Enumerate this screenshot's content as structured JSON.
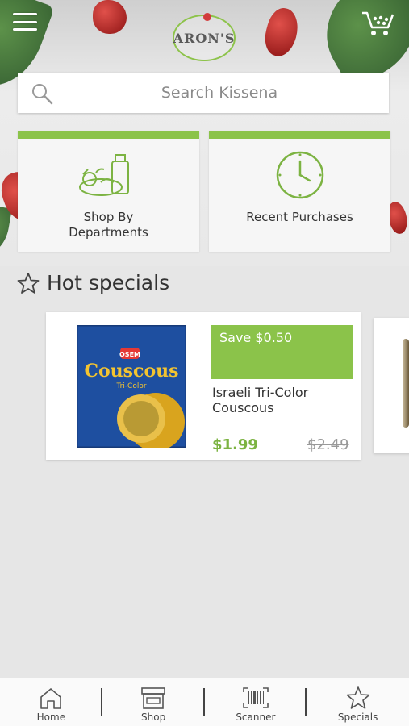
{
  "header": {
    "logo_text": "ARON'S",
    "menu_icon": "hamburger-menu-icon",
    "cart_icon": "shopping-cart-icon"
  },
  "search": {
    "placeholder": "Search Kissena",
    "icon": "search-icon"
  },
  "tiles": [
    {
      "label": "Shop By Departments",
      "icon": "groceries-icon"
    },
    {
      "label": "Recent Purchases",
      "icon": "clock-icon"
    }
  ],
  "specials": {
    "title": "Hot specials",
    "icon": "star-outline-icon",
    "items": [
      {
        "badge": "Save $0.50",
        "name": "Israeli Tri-Color Couscous",
        "price": "$1.99",
        "old_price": "$2.49",
        "image_brand": "OSEM",
        "image_title": "Couscous",
        "image_subtitle": "Tri-Color"
      }
    ]
  },
  "bottom_nav": [
    {
      "label": "Home",
      "icon": "home-icon"
    },
    {
      "label": "Shop",
      "icon": "store-icon"
    },
    {
      "label": "Scanner",
      "icon": "barcode-scanner-icon"
    },
    {
      "label": "Specials",
      "icon": "star-icon"
    }
  ],
  "colors": {
    "accent": "#8bc34a",
    "price": "#7cb342",
    "background": "#e6e6e6"
  }
}
